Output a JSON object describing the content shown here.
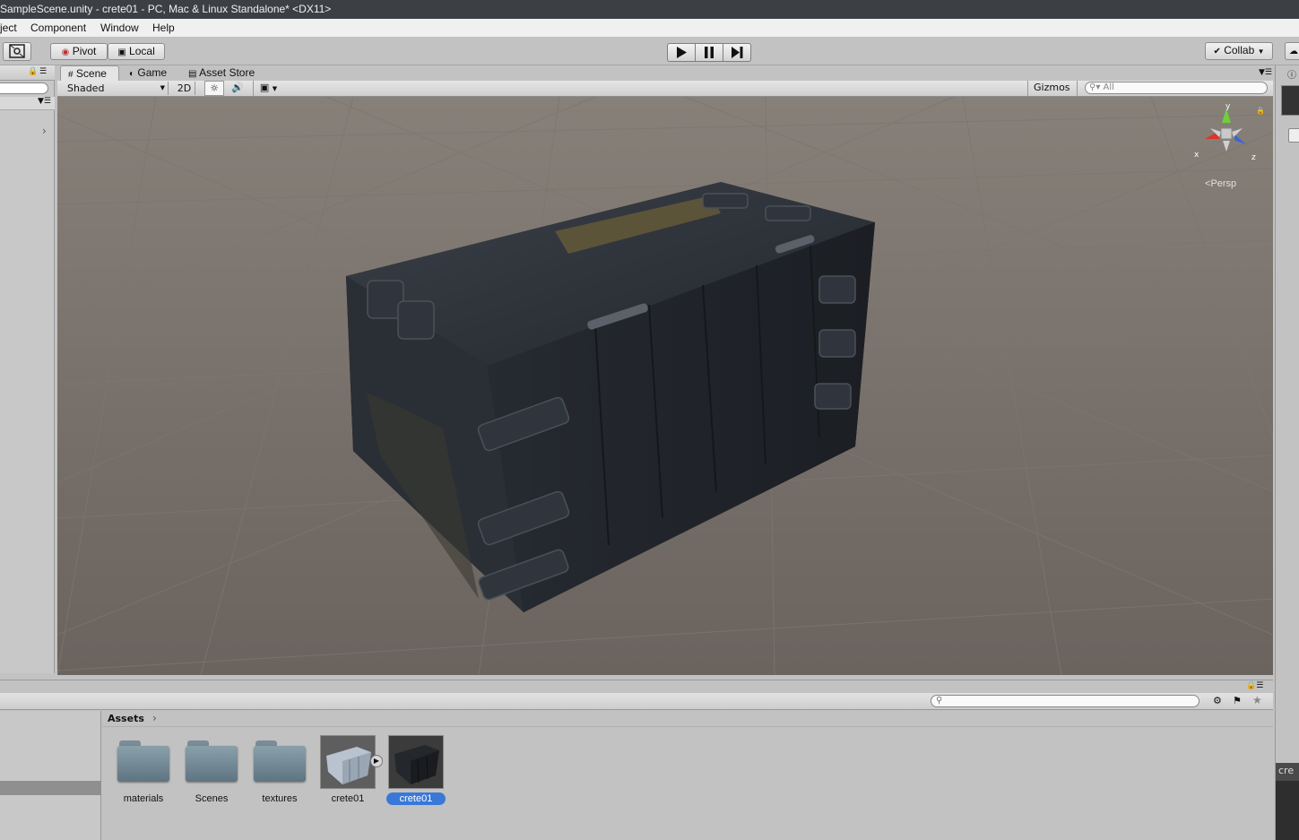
{
  "window": {
    "title": "SampleScene.unity - crete01 - PC, Mac & Linux Standalone* <DX11>"
  },
  "menu": [
    "ject",
    "Component",
    "Window",
    "Help"
  ],
  "toolbar": {
    "pivot_label": "Pivot",
    "local_label": "Local",
    "collab_label": "Collab"
  },
  "tabs": {
    "scene": "Scene",
    "game": "Game",
    "asset_store": "Asset Store"
  },
  "scene_toolbar": {
    "shading_mode": "Shaded",
    "mode_2d": "2D",
    "gizmos_label": "Gizmos",
    "search_placeholder": "All"
  },
  "gizmo": {
    "y": "y",
    "x": "x",
    "z": "z",
    "projection": "Persp"
  },
  "project": {
    "breadcrumb": "Assets",
    "items": [
      {
        "label": "materials",
        "kind": "folder"
      },
      {
        "label": "Scenes",
        "kind": "folder"
      },
      {
        "label": "textures",
        "kind": "folder"
      },
      {
        "label": "crete01",
        "kind": "model"
      },
      {
        "label": "crete01",
        "kind": "prefab",
        "selected": true
      }
    ]
  },
  "inspector_partial": "cre",
  "colors": {
    "selection": "#3a78d8",
    "viewport_bg": "#6e6863",
    "gizmo_y": "#6fcf3a",
    "gizmo_x": "#d8362e",
    "gizmo_z": "#3a64d8"
  }
}
